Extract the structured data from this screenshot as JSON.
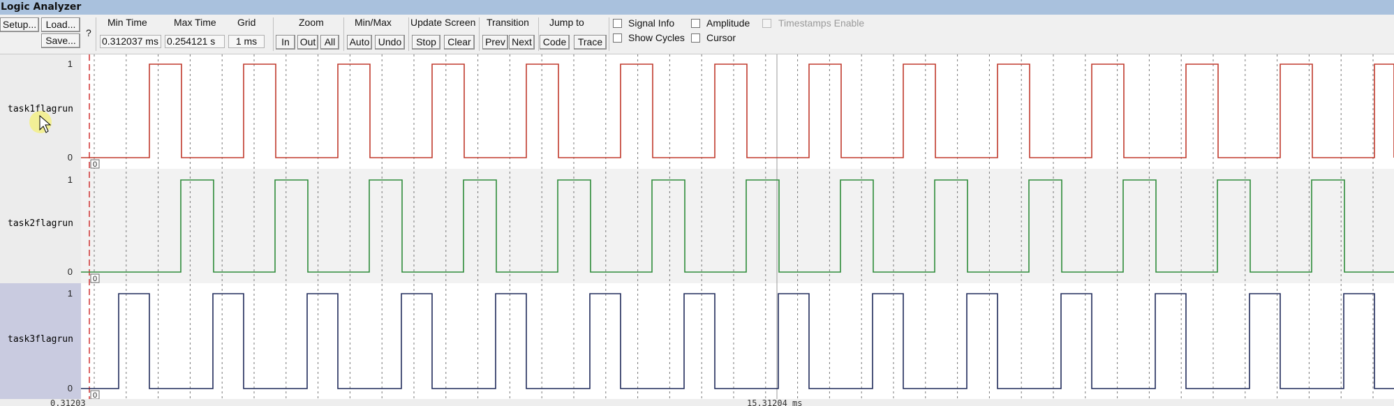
{
  "window": {
    "title": "Logic Analyzer"
  },
  "toolbar": {
    "setup_label": "Setup...",
    "load_label": "Load...",
    "save_label": "Save...",
    "help_label": "?",
    "min_time": {
      "label": "Min Time",
      "value": "0.312037 ms"
    },
    "max_time": {
      "label": "Max Time",
      "value": "0.254121 s"
    },
    "grid": {
      "label": "Grid",
      "value": "1 ms"
    },
    "zoom": {
      "label": "Zoom",
      "in": "In",
      "out": "Out",
      "all": "All"
    },
    "minmax": {
      "label": "Min/Max",
      "auto": "Auto",
      "undo": "Undo"
    },
    "update": {
      "label": "Update Screen",
      "stop": "Stop",
      "clear": "Clear"
    },
    "transition": {
      "label": "Transition",
      "prev": "Prev",
      "next": "Next"
    },
    "jumpto": {
      "label": "Jump to",
      "code": "Code",
      "trace": "Trace"
    },
    "options": {
      "signal_info": "Signal Info",
      "show_cycles": "Show Cycles",
      "amplitude": "Amplitude",
      "cursor": "Cursor",
      "timestamps_enable": "Timestamps Enable"
    }
  },
  "signals": [
    {
      "name": "task1flagrun",
      "color": "#c0392b",
      "high": "1",
      "low": "0",
      "marker": "0"
    },
    {
      "name": "task2flagrun",
      "color": "#2e8b3a",
      "high": "1",
      "low": "0",
      "marker": "0"
    },
    {
      "name": "task3flagrun",
      "color": "#1f2a5a",
      "high": "1",
      "low": "0",
      "marker": "0"
    }
  ],
  "timeline": {
    "left_label": "0.31203",
    "center_label": "15.31204 ms"
  },
  "colors": {
    "titlebar": "#a9c1dd",
    "cursor_line": "#d03030",
    "selected_row": "#c9cbe0",
    "grid": "#777777"
  }
}
